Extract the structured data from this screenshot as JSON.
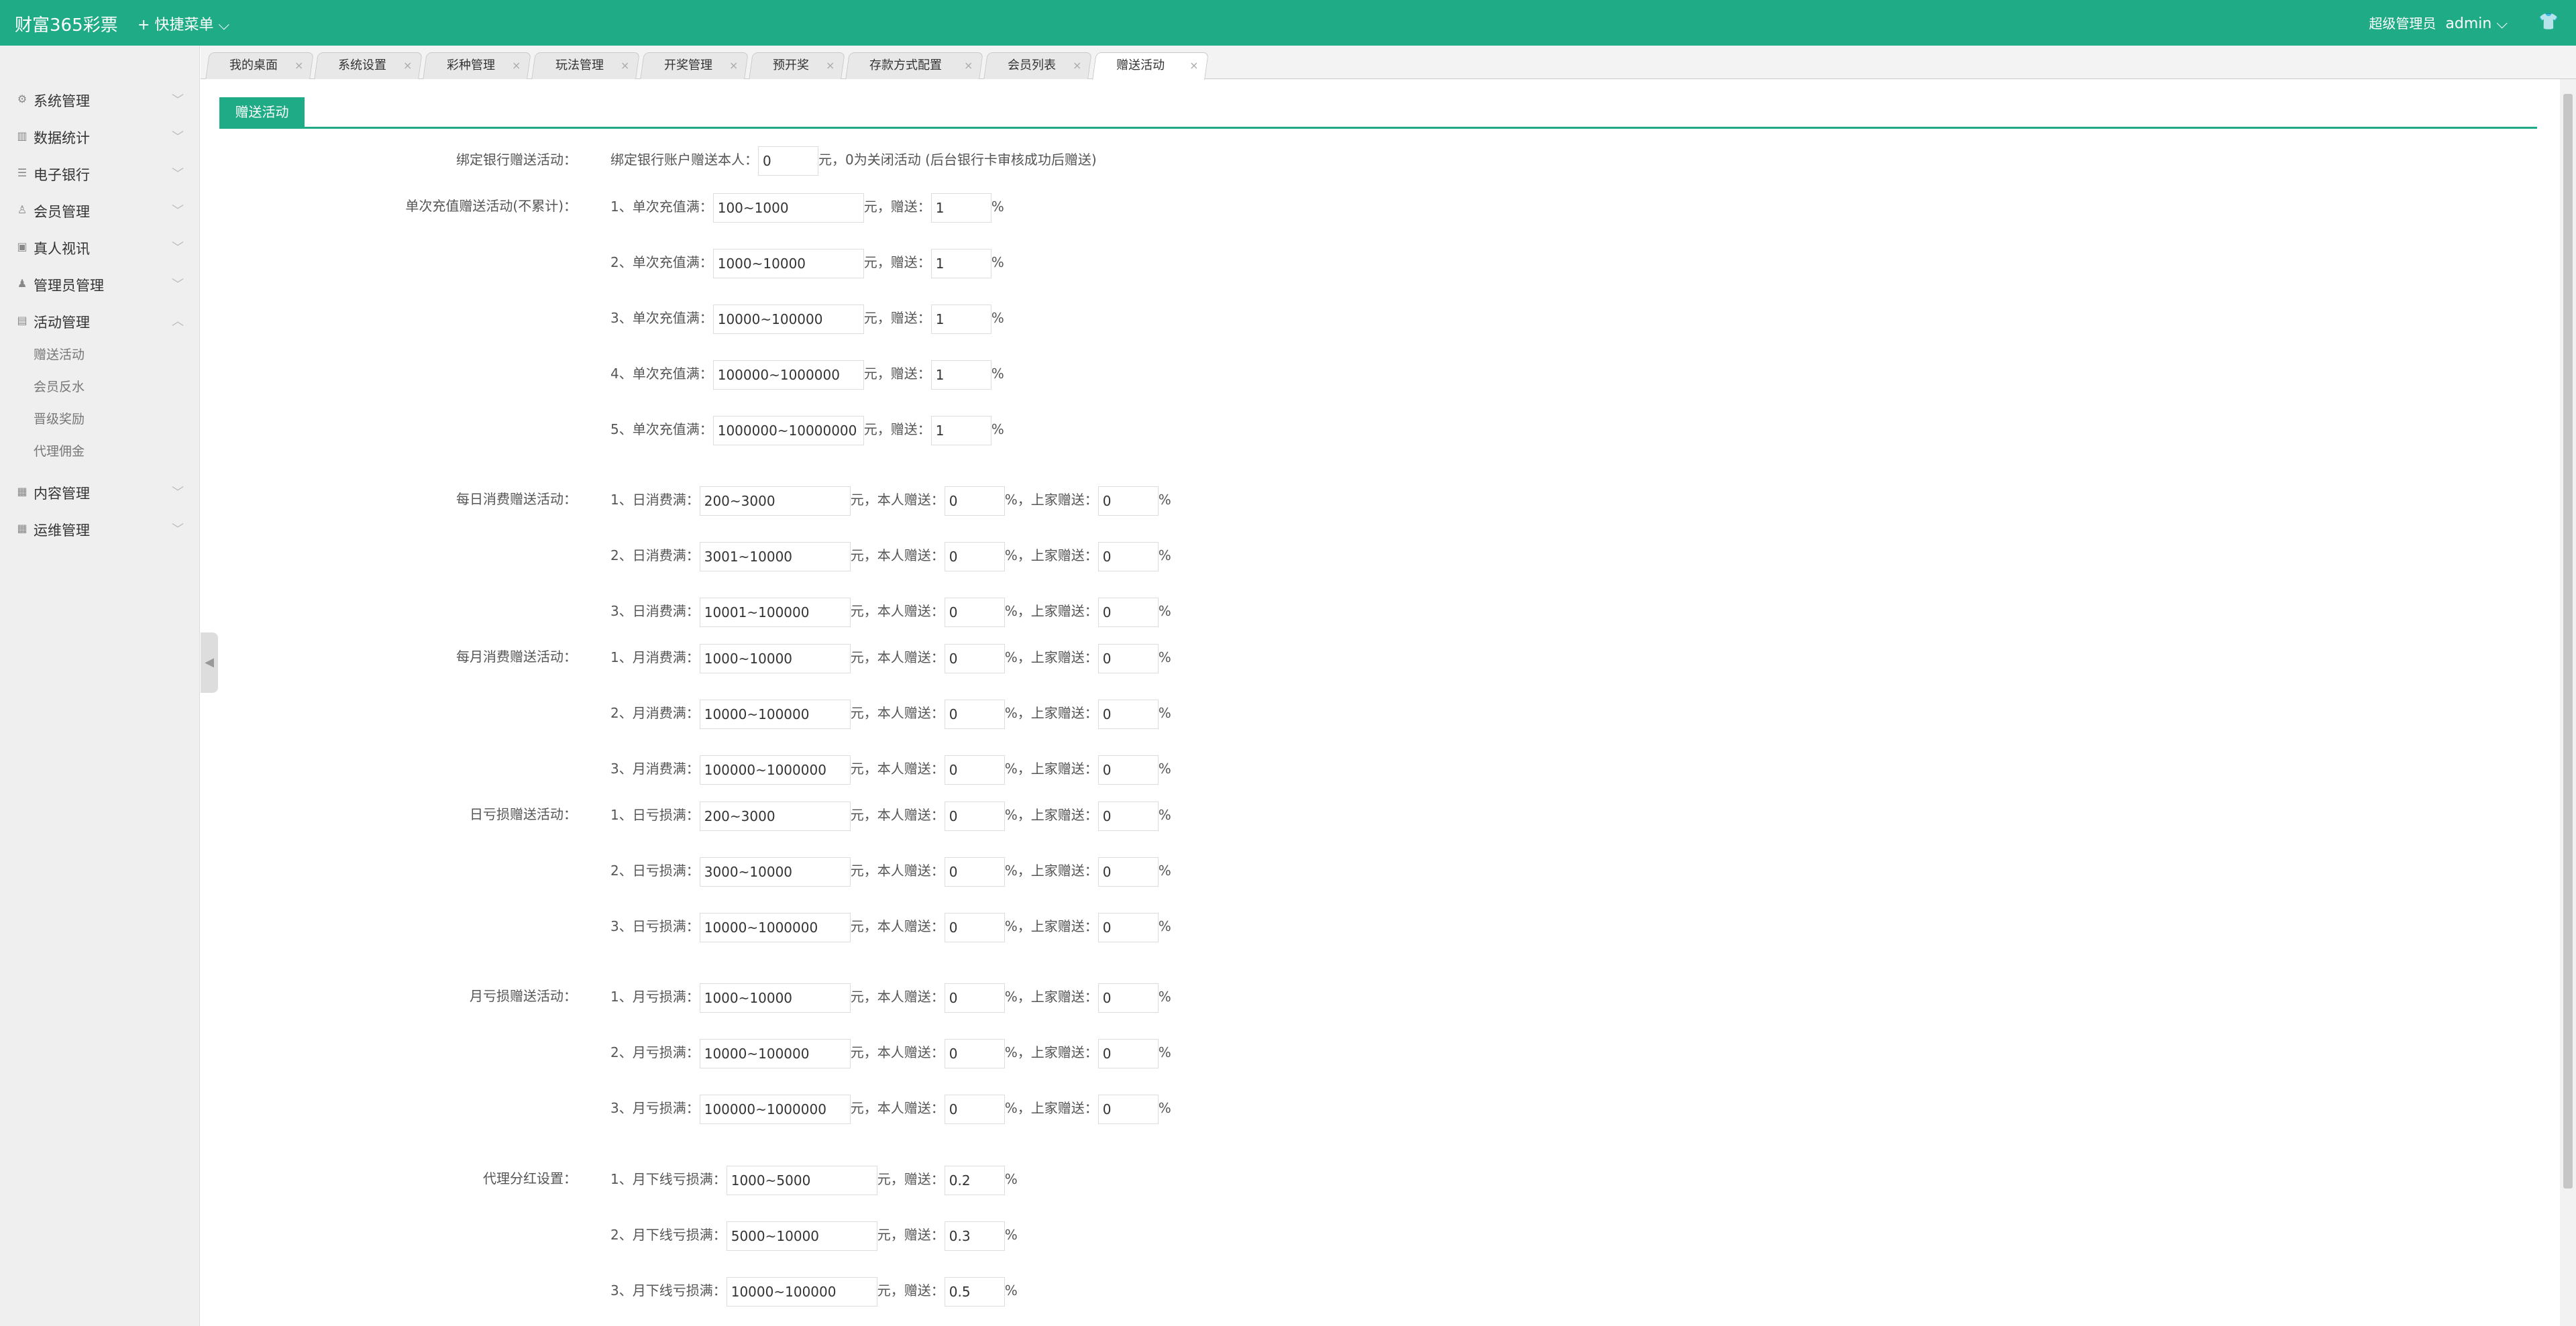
{
  "app": {
    "logo": "财富365彩票",
    "quick_menu": "快捷菜单",
    "role": "超级管理员",
    "user": "admin"
  },
  "sidebar": [
    {
      "label": "系统管理",
      "icon": "gear-icon"
    },
    {
      "label": "数据统计",
      "icon": "chart-icon"
    },
    {
      "label": "电子银行",
      "icon": "list-icon"
    },
    {
      "label": "会员管理",
      "icon": "user-icon"
    },
    {
      "label": "真人视讯",
      "icon": "video-icon"
    },
    {
      "label": "管理员管理",
      "icon": "admin-icon"
    },
    {
      "label": "活动管理",
      "icon": "activity-icon"
    },
    {
      "label": "内容管理",
      "icon": "content-icon"
    },
    {
      "label": "运维管理",
      "icon": "ops-icon"
    }
  ],
  "sub_items": [
    "赠送活动",
    "会员反水",
    "晋级奖励",
    "代理佣金"
  ],
  "tabs": [
    "我的桌面",
    "系统设置",
    "彩种管理",
    "玩法管理",
    "开奖管理",
    "预开奖",
    "存款方式配置",
    "会员列表",
    "赠送活动"
  ],
  "section_title": "赠送活动",
  "bank": {
    "label": "绑定银行赠送活动：",
    "prefix": "绑定银行账户赠送本人：",
    "value": "0",
    "suffix": "元，0为关闭活动 (后台银行卡审核成功后赠送)"
  },
  "recharge": {
    "label": "单次充值赠送活动(不累计)：",
    "rows": [
      {
        "prefix": "1、单次充值满：",
        "range": "100~1000",
        "mid": "元，赠送：",
        "rate": "1",
        "unit": "%"
      },
      {
        "prefix": "2、单次充值满：",
        "range": "1000~10000",
        "mid": "元，赠送：",
        "rate": "1",
        "unit": "%"
      },
      {
        "prefix": "3、单次充值满：",
        "range": "10000~100000",
        "mid": "元，赠送：",
        "rate": "1",
        "unit": "%"
      },
      {
        "prefix": "4、单次充值满：",
        "range": "100000~1000000",
        "mid": "元，赠送：",
        "rate": "1",
        "unit": "%"
      },
      {
        "prefix": "5、单次充值满：",
        "range": "1000000~10000000",
        "mid": "元，赠送：",
        "rate": "1",
        "unit": "%"
      }
    ]
  },
  "daily": {
    "label": "每日消费赠送活动：",
    "rows": [
      {
        "prefix": "1、日消费满：",
        "range": "200~3000",
        "self": "元，本人赠送：",
        "self_v": "0",
        "up": "%，上家赠送：",
        "up_v": "0",
        "unit": "%"
      },
      {
        "prefix": "2、日消费满：",
        "range": "3001~10000",
        "self": "元，本人赠送：",
        "self_v": "0",
        "up": "%，上家赠送：",
        "up_v": "0",
        "unit": "%"
      },
      {
        "prefix": "3、日消费满：",
        "range": "10001~100000",
        "self": "元，本人赠送：",
        "self_v": "0",
        "up": "%，上家赠送：",
        "up_v": "0",
        "unit": "%"
      }
    ]
  },
  "monthly": {
    "label": "每月消费赠送活动：",
    "rows": [
      {
        "prefix": "1、月消费满：",
        "range": "1000~10000",
        "self": "元，本人赠送：",
        "self_v": "0",
        "up": "%，上家赠送：",
        "up_v": "0",
        "unit": "%"
      },
      {
        "prefix": "2、月消费满：",
        "range": "10000~100000",
        "self": "元，本人赠送：",
        "self_v": "0",
        "up": "%，上家赠送：",
        "up_v": "0",
        "unit": "%"
      },
      {
        "prefix": "3、月消费满：",
        "range": "100000~1000000",
        "self": "元，本人赠送：",
        "self_v": "0",
        "up": "%，上家赠送：",
        "up_v": "0",
        "unit": "%"
      }
    ]
  },
  "dayloss": {
    "label": "日亏损赠送活动：",
    "rows": [
      {
        "prefix": "1、日亏损满：",
        "range": "200~3000",
        "self": "元，本人赠送：",
        "self_v": "0",
        "up": "%，上家赠送：",
        "up_v": "0",
        "unit": "%"
      },
      {
        "prefix": "2、日亏损满：",
        "range": "3000~10000",
        "self": "元，本人赠送：",
        "self_v": "0",
        "up": "%，上家赠送：",
        "up_v": "0",
        "unit": "%"
      },
      {
        "prefix": "3、日亏损满：",
        "range": "10000~1000000",
        "self": "元，本人赠送：",
        "self_v": "0",
        "up": "%，上家赠送：",
        "up_v": "0",
        "unit": "%"
      }
    ]
  },
  "monthloss": {
    "label": "月亏损赠送活动：",
    "rows": [
      {
        "prefix": "1、月亏损满：",
        "range": "1000~10000",
        "self": "元，本人赠送：",
        "self_v": "0",
        "up": "%，上家赠送：",
        "up_v": "0",
        "unit": "%"
      },
      {
        "prefix": "2、月亏损满：",
        "range": "10000~100000",
        "self": "元，本人赠送：",
        "self_v": "0",
        "up": "%，上家赠送：",
        "up_v": "0",
        "unit": "%"
      },
      {
        "prefix": "3、月亏损满：",
        "range": "100000~1000000",
        "self": "元，本人赠送：",
        "self_v": "0",
        "up": "%，上家赠送：",
        "up_v": "0",
        "unit": "%"
      }
    ]
  },
  "agent": {
    "label": "代理分红设置：",
    "rows": [
      {
        "prefix": "1、月下线亏损满：",
        "range": "1000~5000",
        "mid": "元，赠送：",
        "rate": "0.2",
        "unit": "%"
      },
      {
        "prefix": "2、月下线亏损满：",
        "range": "5000~10000",
        "mid": "元，赠送：",
        "rate": "0.3",
        "unit": "%"
      },
      {
        "prefix": "3、月下线亏损满：",
        "range": "10000~100000",
        "mid": "元，赠送：",
        "rate": "0.5",
        "unit": "%"
      }
    ]
  }
}
